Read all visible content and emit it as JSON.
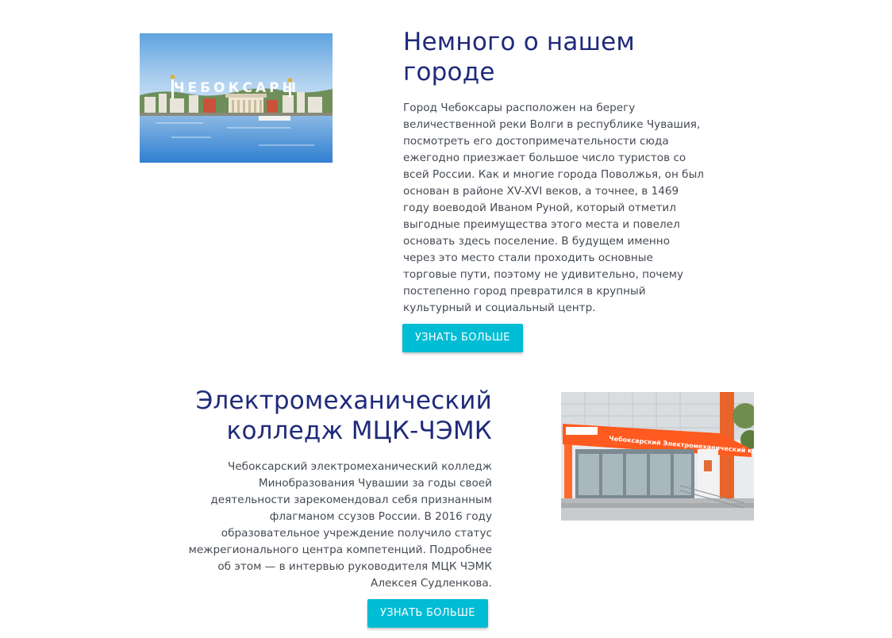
{
  "city": {
    "image_caption": "ЧЕБОКСАРЫ",
    "title": "Немного о нашем городе",
    "text": "Город Чебоксары расположен на берегу величественной реки Волги в республике Чувашия, посмотреть его достопримечательности сюда ежегодно приезжает большое число туристов со всей России. Как и многие города Поволжья, он был основан в районе XV-XVI веков, а точнее, в 1469 году воеводой Иваном Руной, который отметил выгодные преимущества этого места и повелел основать здесь поселение. В будущем именно через это место стали проходить основные торговые пути, поэтому не удивительно, почему постепенно город превратился в крупный культурный и социальный центр.",
    "button_label": "УЗНАТЬ БОЛЬШЕ"
  },
  "college": {
    "title": "Электромеханический колледж МЦК-ЧЭМК",
    "text": "Чебоксарский электромеханический колледж Минобразования Чувашии за годы своей деятельности зарекомендовал себя признанным флагманом ссузов России. В 2016 году образовательное учреждение получило статус межрегионального центра компетенций. Подробнее об этом — в интервью руководителя МЦК ЧЭМК Алексея Судленкова.",
    "button_label": "УЗНАТЬ БОЛЬШЕ",
    "image_sign": "Чебоксарский Электромеханический колледж"
  },
  "colors": {
    "heading": "#1f2a7a",
    "body_text": "#444a52",
    "button": "#00bcd4",
    "college_orange": "#ff5a1f"
  }
}
